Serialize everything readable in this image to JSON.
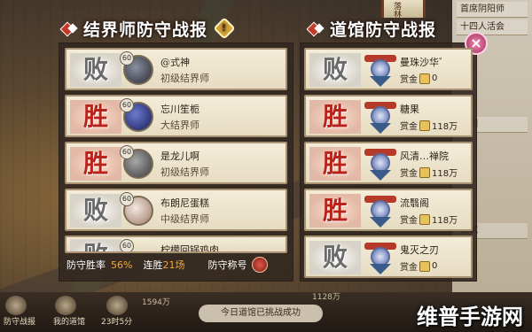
{
  "left_header": {
    "title": "结界师防守战报",
    "warn": "!"
  },
  "right_header": {
    "title": "道馆防守战报"
  },
  "left_rows": [
    {
      "result": "败",
      "level": "60",
      "name": "@式神",
      "title": "初级结界师"
    },
    {
      "result": "胜",
      "level": "60",
      "name": "忘川笙栀",
      "title": "大结界师"
    },
    {
      "result": "胜",
      "level": "60",
      "name": "是龙儿啊",
      "title": "初级结界师"
    },
    {
      "result": "败",
      "level": "60",
      "name": "布朗尼蛋糕",
      "title": "中级结界师"
    },
    {
      "result": "败",
      "level": "60",
      "name": "柠檬回锅鸡肉",
      "title": ""
    }
  ],
  "stats": {
    "defense_rate_label": "防守胜率",
    "defense_rate": "56%",
    "streak_label": "连胜",
    "streak": "21场",
    "title_label": "防守称号"
  },
  "right_rows": [
    {
      "result": "败",
      "name": "曼珠沙华゛",
      "bounty_label": "赏金",
      "bounty": "0"
    },
    {
      "result": "胜",
      "name": "糖果",
      "bounty_label": "赏金",
      "bounty": "118万"
    },
    {
      "result": "胜",
      "name": "风清…禅院",
      "bounty_label": "赏金",
      "bounty": "118万"
    },
    {
      "result": "胜",
      "name": "流翳阁",
      "bounty_label": "赏金",
      "bounty": "118万"
    },
    {
      "result": "败",
      "name": "鬼灭之刃",
      "bounty_label": "赏金",
      "bounty": "0"
    }
  ],
  "close": "×",
  "side_list": [
    "首席阴阳师",
    "十四人活会",
    "",
    "",
    "晴明",
    "",
    "",
    "",
    "孤城",
    "",
    "",
    "",
    "",
    ""
  ],
  "bottom": {
    "items": [
      "防守战报",
      "我的道馆",
      "23时5分"
    ],
    "numbers": [
      "1594万",
      "1128万"
    ],
    "notice": "今日道馆已挑战成功"
  },
  "watermark": "维普手游网",
  "colors": {
    "win": "#b8231b",
    "lose": "#6a6a6a",
    "accent": "#f0a83a"
  }
}
